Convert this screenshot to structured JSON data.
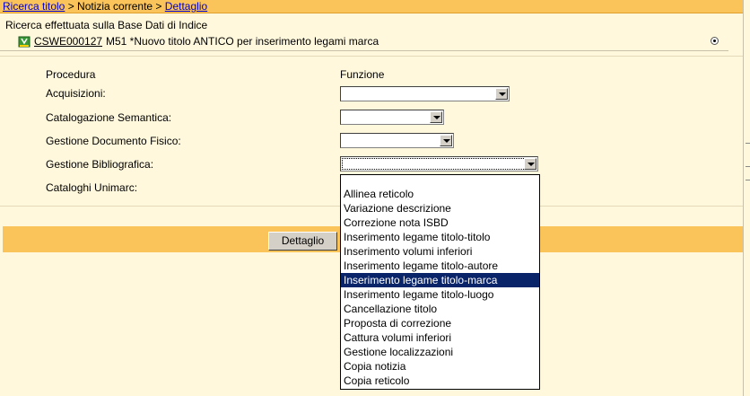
{
  "breadcrumb": {
    "link1": "Ricerca titolo",
    "sep1": " > ",
    "current": "Notizia corrente",
    "sep2": " > ",
    "link2": "Dettaglio"
  },
  "search_info": "Ricerca effettuata sulla Base Dati di Indice",
  "record": {
    "icon": "book-icon",
    "id": "CSWE000127",
    "description": "M51 *Nuovo titolo ANTICO per inserimento legami marca"
  },
  "form": {
    "header_procedura": "Procedura",
    "header_funzione": "Funzione",
    "rows": [
      {
        "label": "Acquisizioni:",
        "value": ""
      },
      {
        "label": "Catalogazione Semantica:",
        "value": ""
      },
      {
        "label": "Gestione Documento Fisico:",
        "value": ""
      },
      {
        "label": "Gestione Bibliografica:",
        "value": ""
      },
      {
        "label": "Cataloghi Unimarc:",
        "value": ""
      }
    ]
  },
  "action": {
    "button_label": "Dettaglio"
  },
  "dropdown": {
    "items": [
      "Allinea reticolo",
      "Variazione descrizione",
      "Correzione nota ISBD",
      "Inserimento legame titolo-titolo",
      "Inserimento volumi inferiori",
      "Inserimento legame titolo-autore",
      "Inserimento legame titolo-marca",
      "Inserimento legame titolo-luogo",
      "Cancellazione titolo",
      "Proposta di correzione",
      "Cattura volumi inferiori",
      "Gestione localizzazioni",
      "Copia notizia",
      "Copia reticolo"
    ],
    "highlighted": "Inserimento legame titolo-marca"
  },
  "colors": {
    "bar": "#fbc45a",
    "background": "#fff8dc",
    "highlight": "#0a246a"
  }
}
